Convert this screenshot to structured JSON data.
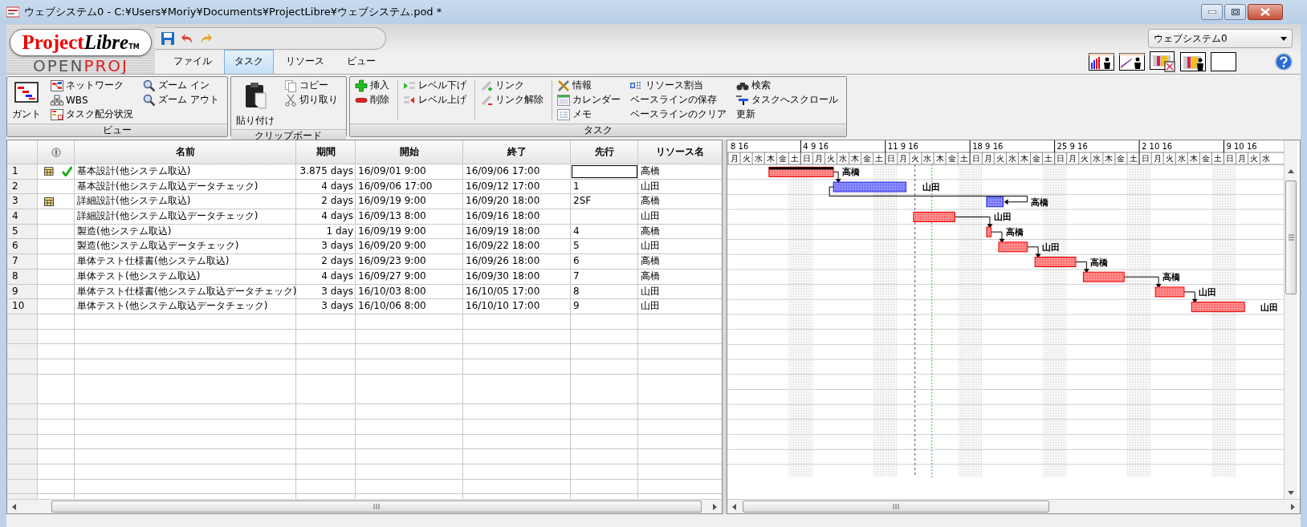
{
  "window": {
    "title": "ウェブシステム0 - C:¥Users¥Moriy¥Documents¥ProjectLibre¥ウェブシステム.pod *"
  },
  "logo": {
    "brand_a": "Project",
    "brand_b": "Libre",
    "tm": "TM",
    "sub_a": "OPEN",
    "sub_b": "PROJ"
  },
  "tabs": [
    {
      "label": "ファイル",
      "selected": false
    },
    {
      "label": "タスク",
      "selected": true
    },
    {
      "label": "リソース",
      "selected": false
    },
    {
      "label": "ビュー",
      "selected": false
    }
  ],
  "project_selector": {
    "value": "ウェブシステム0"
  },
  "ribbon": [
    {
      "label": "ビュー",
      "columns": [
        {
          "kind": "buttons",
          "items": [
            {
              "label": "ガント",
              "kind": "large"
            }
          ]
        },
        {
          "kind": "buttons",
          "items": [
            {
              "label": "ネットワーク",
              "kind": "small"
            },
            {
              "label": "WBS",
              "kind": "small"
            },
            {
              "label": "タスク配分状況",
              "kind": "small"
            }
          ]
        },
        {
          "kind": "buttons",
          "items": [
            {
              "label": "ズーム イン",
              "kind": "small"
            },
            {
              "label": "ズーム アウト",
              "kind": "small"
            }
          ]
        }
      ]
    },
    {
      "label": "クリップボード",
      "columns": [
        {
          "kind": "buttons",
          "items": [
            {
              "label": "貼り付け",
              "kind": "large"
            }
          ]
        },
        {
          "kind": "buttons",
          "items": [
            {
              "label": "コピー",
              "kind": "small"
            },
            {
              "label": "切り取り",
              "kind": "small"
            }
          ]
        }
      ]
    },
    {
      "label": "タスク",
      "columns": [
        {
          "kind": "buttons",
          "items": [
            {
              "label": "挿入",
              "kind": "small"
            },
            {
              "label": "削除",
              "kind": "small"
            }
          ]
        },
        {
          "kind": "separator"
        },
        {
          "kind": "buttons",
          "items": [
            {
              "label": "レベル下げ",
              "kind": "small"
            },
            {
              "label": "レベル上げ",
              "kind": "small"
            }
          ]
        },
        {
          "kind": "separator"
        },
        {
          "kind": "buttons",
          "items": [
            {
              "label": "リンク",
              "kind": "small"
            },
            {
              "label": "リンク解除",
              "kind": "small"
            }
          ]
        },
        {
          "kind": "separator"
        },
        {
          "kind": "buttons",
          "items": [
            {
              "label": "情報",
              "kind": "small"
            },
            {
              "label": "カレンダー",
              "kind": "small"
            },
            {
              "label": "メモ",
              "kind": "small"
            }
          ]
        },
        {
          "kind": "buttons",
          "items": [
            {
              "label": "リソース割当",
              "kind": "small"
            },
            {
              "label": "ベースラインの保存",
              "kind": "text"
            },
            {
              "label": "ベースラインのクリア",
              "kind": "text"
            }
          ]
        },
        {
          "kind": "buttons",
          "items": [
            {
              "label": "検索",
              "kind": "small"
            },
            {
              "label": "タスクへスクロール",
              "kind": "small"
            },
            {
              "label": "更新",
              "kind": "text"
            }
          ]
        }
      ]
    }
  ],
  "table": {
    "columns": [
      "名前",
      "期間",
      "開始",
      "終了",
      "先行",
      "リソース名"
    ],
    "rows": [
      {
        "id": "1",
        "calendar": true,
        "complete": true,
        "name": "基本設計(他システム取込)",
        "duration": "3.875 days",
        "start": "16/09/01 9:00",
        "finish": "16/09/06 17:00",
        "resource": "高橋",
        "focused": true
      },
      {
        "id": "2",
        "calendar": false,
        "complete": false,
        "name": "基本設計(他システム取込データチェック)",
        "duration": "4 days",
        "start": "16/09/06 17:00",
        "finish": "16/09/12 17:00",
        "predecessors": "1",
        "resource": "山田",
        "focused": false
      },
      {
        "id": "3",
        "calendar": true,
        "complete": false,
        "name": "詳細設計(他システム取込)",
        "duration": "2 days",
        "start": "16/09/19 9:00",
        "finish": "16/09/20 18:00",
        "predecessors": "2SF",
        "resource": "高橋",
        "focused": false
      },
      {
        "id": "4",
        "calendar": false,
        "complete": false,
        "name": "詳細設計(他システム取込データチェック)",
        "duration": "4 days",
        "start": "16/09/13 8:00",
        "finish": "16/09/16 18:00",
        "resource": "山田",
        "focused": false
      },
      {
        "id": "5",
        "calendar": false,
        "complete": false,
        "name": "製造(他システム取込)",
        "duration": "1 day",
        "start": "16/09/19 9:00",
        "finish": "16/09/19 18:00",
        "predecessors": "4",
        "resource": "高橋",
        "focused": false
      },
      {
        "id": "6",
        "calendar": false,
        "complete": false,
        "name": "製造(他システム取込データチェック)",
        "duration": "3 days",
        "start": "16/09/20 9:00",
        "finish": "16/09/22 18:00",
        "predecessors": "5",
        "resource": "山田",
        "focused": false
      },
      {
        "id": "7",
        "calendar": false,
        "complete": false,
        "name": "単体テスト仕様書(他システム取込)",
        "duration": "2 days",
        "start": "16/09/23 9:00",
        "finish": "16/09/26 18:00",
        "predecessors": "6",
        "resource": "高橋",
        "focused": false
      },
      {
        "id": "8",
        "calendar": false,
        "complete": false,
        "name": "単体テスト(他システム取込)",
        "duration": "4 days",
        "start": "16/09/27 9:00",
        "finish": "16/09/30 18:00",
        "predecessors": "7",
        "resource": "高橋",
        "focused": false
      },
      {
        "id": "9",
        "calendar": false,
        "complete": false,
        "name": "単体テスト仕様書(他システム取込データチェック)",
        "duration": "3 days",
        "start": "16/10/03 8:00",
        "finish": "16/10/05 17:00",
        "predecessors": "8",
        "resource": "山田",
        "focused": false
      },
      {
        "id": "10",
        "calendar": false,
        "complete": false,
        "name": "単体テスト(他システム取込データチェック)",
        "duration": "3 days",
        "start": "16/10/06 8:00",
        "finish": "16/10/10 17:00",
        "predecessors": "9",
        "resource": "山田",
        "focused": false
      }
    ]
  },
  "gantt": {
    "weeks": [
      {
        "label": "8 16",
        "days": [
          "月",
          "火",
          "水",
          "木",
          "金",
          "土"
        ]
      },
      {
        "label": "4 9 16",
        "days": [
          "日",
          "月",
          "火",
          "水",
          "木",
          "金",
          "土"
        ]
      },
      {
        "label": "11 9 16",
        "days": [
          "日",
          "月",
          "火",
          "水",
          "木",
          "金",
          "土"
        ]
      },
      {
        "label": "18 9 16",
        "days": [
          "日",
          "月",
          "火",
          "水",
          "木",
          "金",
          "土"
        ]
      },
      {
        "label": "25 9 16",
        "days": [
          "日",
          "月",
          "火",
          "水",
          "木",
          "金",
          "土"
        ]
      },
      {
        "label": "2 10 16",
        "days": [
          "日",
          "月",
          "火",
          "水",
          "木",
          "金",
          "土"
        ]
      },
      {
        "label": "9 10 16",
        "days": [
          "日",
          "月",
          "火",
          "水"
        ]
      }
    ],
    "bars": [
      {
        "critical": true,
        "label": "高橋"
      },
      {
        "critical": false,
        "label": "山田"
      },
      {
        "critical": false,
        "label": "高橋"
      },
      {
        "critical": true,
        "label": "山田"
      },
      {
        "critical": true,
        "label": "高橋"
      },
      {
        "critical": true,
        "label": "山田"
      },
      {
        "critical": true,
        "label": "高橋"
      },
      {
        "critical": true,
        "label": "高橋"
      },
      {
        "critical": true,
        "label": "山田"
      },
      {
        "critical": true,
        "label": "山田"
      }
    ]
  }
}
